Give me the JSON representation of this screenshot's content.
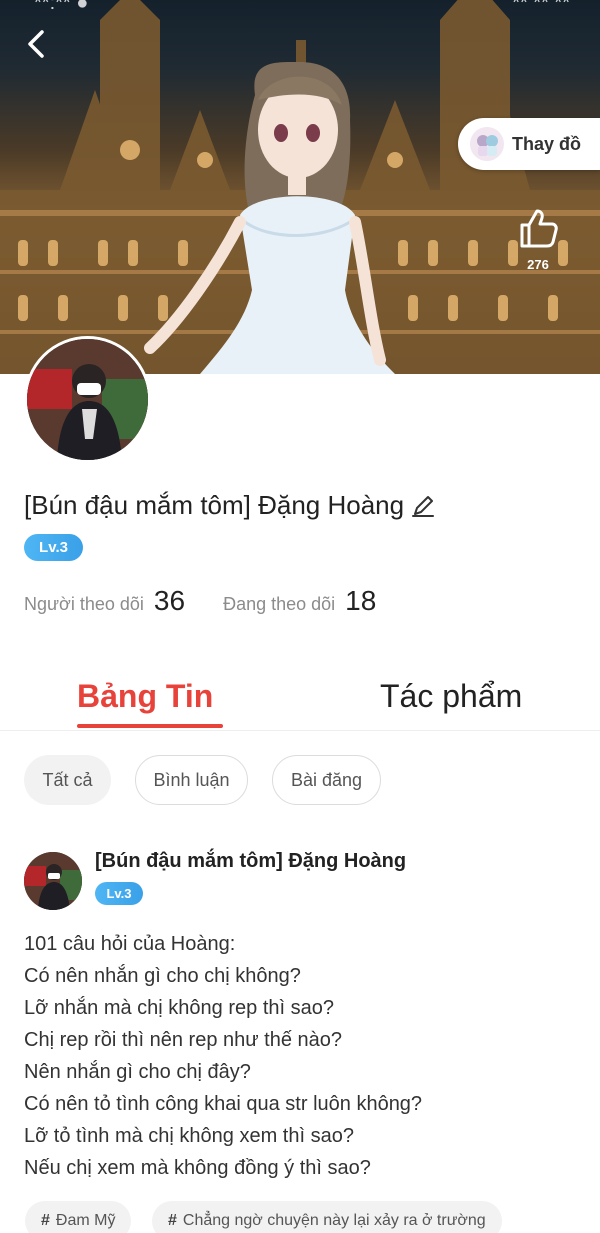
{
  "status_bar": {
    "left_fragment": "**:** ●",
    "right_fragment": "** ** **"
  },
  "header": {
    "back_icon": "chevron-left-icon",
    "change_outfit_label": "Thay đồ",
    "like_count": "276"
  },
  "profile": {
    "name": "[Bún đậu mắm tôm] Đặng Hoàng",
    "level": "Lv.3",
    "followers_label": "Người theo dõi",
    "followers_count": "36",
    "following_label": "Đang theo dõi",
    "following_count": "18"
  },
  "tabs": [
    {
      "label": "Bảng Tin",
      "active": true
    },
    {
      "label": "Tác phẩm",
      "active": false
    }
  ],
  "filters": [
    {
      "label": "Tất cả",
      "selected": true
    },
    {
      "label": "Bình luận",
      "selected": false
    },
    {
      "label": "Bài đăng",
      "selected": false
    }
  ],
  "post": {
    "author": "[Bún đậu mắm tôm] Đặng Hoàng",
    "level": "Lv.3",
    "lines": [
      "101 câu hỏi của Hoàng:",
      "Có nên nhắn gì cho chị không?",
      "Lỡ nhắn mà chị không rep thì sao?",
      "Chị rep rồi thì nên rep như thế nào?",
      "Nên nhắn gì cho chị đây?",
      "Có nên tỏ tình công khai qua str luôn không?",
      "Lỡ tỏ tình mà chị không xem thì sao?",
      "Nếu chị xem mà không đồng ý thì sao?"
    ],
    "tags": [
      {
        "hash": "#",
        "label": "Đam Mỹ"
      },
      {
        "hash": "#",
        "label": "Chẳng ngờ chuyện này lại xảy ra ở trường"
      }
    ]
  },
  "colors": {
    "accent": "#e8433b",
    "level_badge": "#3aa0e8",
    "chip_bg": "#f2f2f2"
  }
}
